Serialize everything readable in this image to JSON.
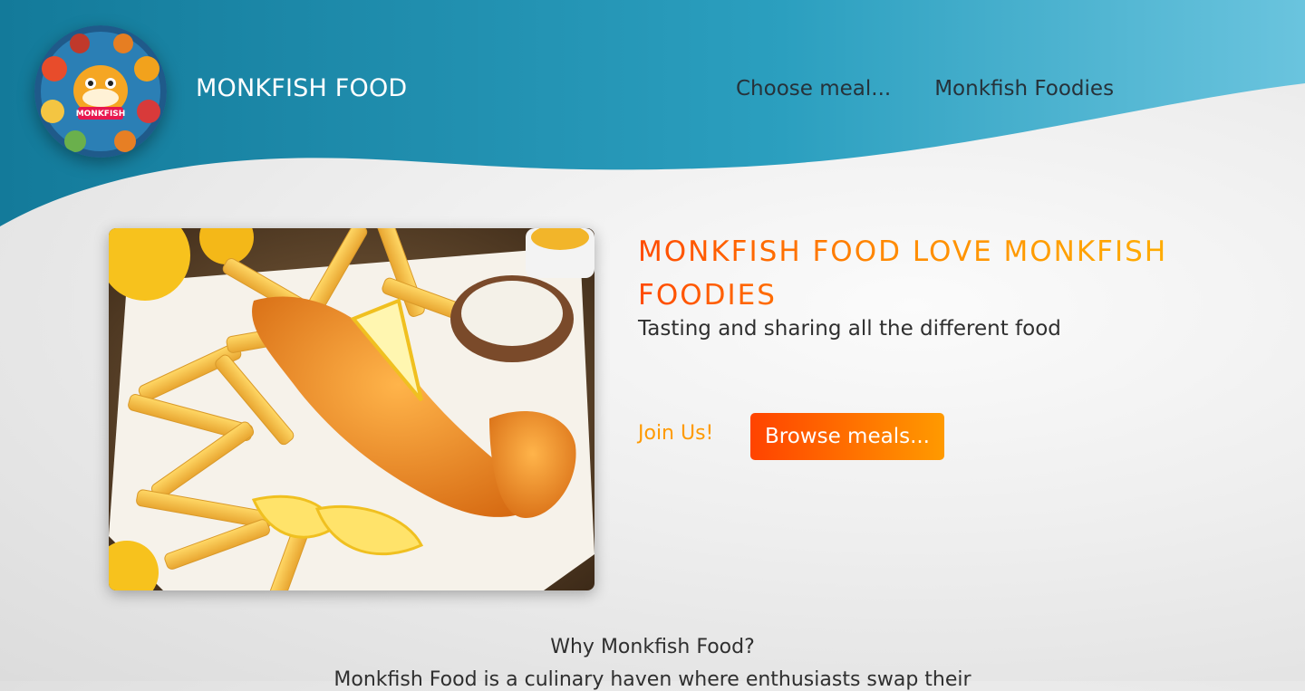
{
  "header": {
    "brand": "MONKFISH FOOD",
    "logo_text": "MONKFISH",
    "nav": [
      {
        "label": "Choose meal..."
      },
      {
        "label": "Monkfish Foodies"
      }
    ]
  },
  "hero": {
    "image_icon": "fish-and-chips-image",
    "title": "MONKFISH FOOD LOVE MONKFISH FOODIES",
    "subtitle": "Tasting and sharing all the different food",
    "join_label": "Join Us!",
    "browse_label": "Browse meals..."
  },
  "about": {
    "heading": "Why Monkfish Food?",
    "text": "Monkfish Food is a culinary haven where enthusiasts swap their"
  },
  "colors": {
    "header_blue": "#1a7f9f",
    "header_light": "#6cc3dc",
    "accent_orange": "#ff4a00",
    "accent_yellow": "#ffb000"
  }
}
